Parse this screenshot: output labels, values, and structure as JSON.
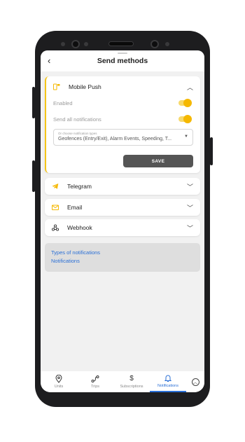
{
  "header": {
    "title": "Send methods",
    "back_icon": "‹"
  },
  "mobile_push": {
    "label": "Mobile Push",
    "enabled_label": "Enabled",
    "enabled": true,
    "send_all_label": "Send all notifications",
    "send_all": true,
    "select_placeholder": "Or choose notification types",
    "select_value": "Geofences (Entry/Exit), Alarm Events, Speeding, T...",
    "save_label": "SAVE",
    "accent_color": "#f5c518"
  },
  "methods": [
    {
      "label": "Telegram"
    },
    {
      "label": "Email"
    },
    {
      "label": "Webhook"
    }
  ],
  "info_links": [
    {
      "label": "Types of notifications"
    },
    {
      "label": "Notifications"
    }
  ],
  "tabs": [
    {
      "label": "Units",
      "icon": "location-pin-icon"
    },
    {
      "label": "Trips",
      "icon": "route-icon"
    },
    {
      "label": "Subscriptions",
      "icon": "dollar-icon"
    },
    {
      "label": "Notifications",
      "icon": "bell-icon",
      "active": true
    }
  ],
  "colors": {
    "link": "#2a6fd6",
    "toggle": "#f5b800",
    "button": "#555555"
  }
}
